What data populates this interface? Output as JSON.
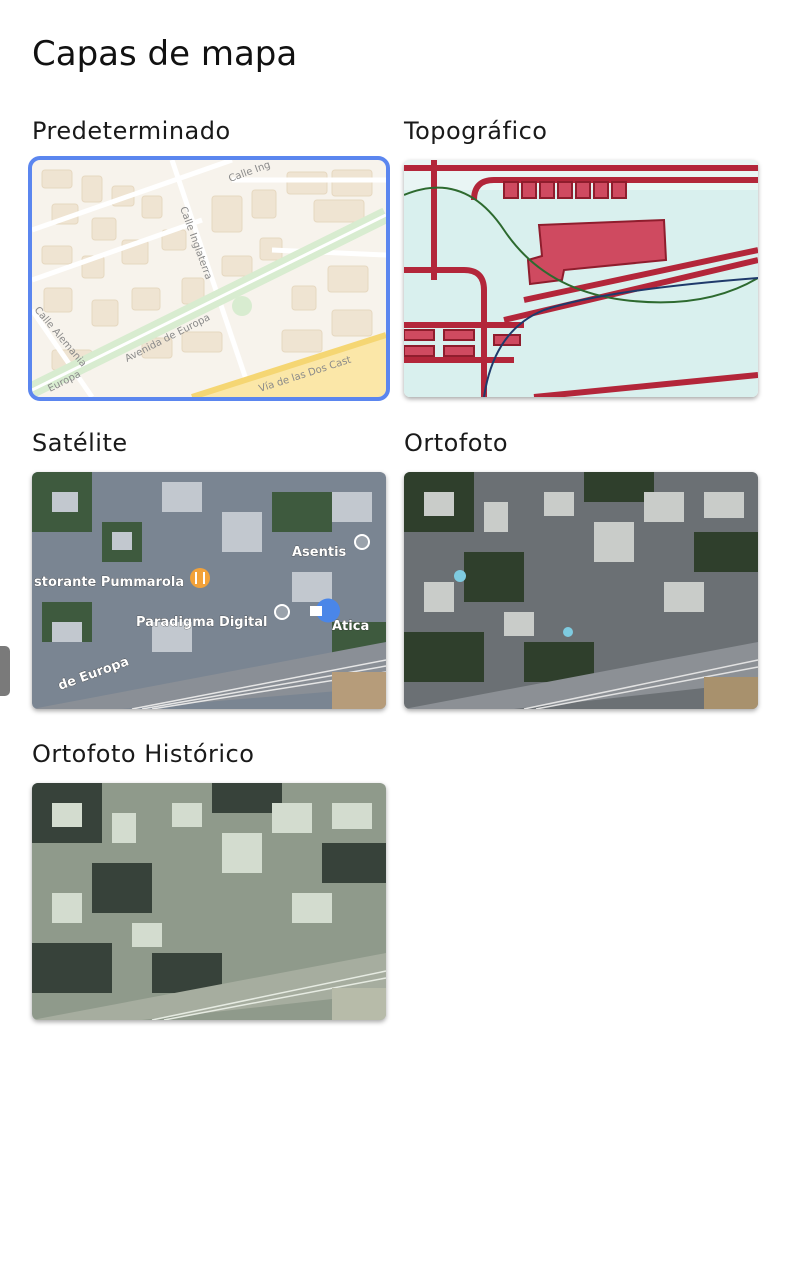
{
  "page": {
    "title": "Capas de mapa"
  },
  "layers": [
    {
      "label": "Predeterminado",
      "selected": true,
      "style": "default",
      "streets": [
        "Calle Ing",
        "Calle Inglaterra",
        "Calle Alemania",
        "Avenida de Europa",
        "Europa",
        "Vía de las Dos Cast"
      ]
    },
    {
      "label": "Topográfico",
      "selected": false,
      "style": "topographic"
    },
    {
      "label": "Satélite",
      "selected": false,
      "style": "satellite",
      "pois": [
        "storante Pummarola",
        "Paradigma Digital",
        "Atica",
        "Asentis",
        "de Europa"
      ]
    },
    {
      "label": "Ortofoto",
      "selected": false,
      "style": "orthophoto"
    },
    {
      "label": "Ortofoto Histórico",
      "selected": false,
      "style": "historic-orthophoto"
    }
  ],
  "colors": {
    "accent": "#5b86ef",
    "map_bg": "#f7f3ec",
    "topo_red": "#b3263a",
    "topo_water": "#d9f0ee"
  },
  "icons": {
    "edge_handle": "drag-handle-icon",
    "restaurant": "fork-knife-icon",
    "shopping": "shopping-bag-icon",
    "place": "place-pin-icon"
  }
}
